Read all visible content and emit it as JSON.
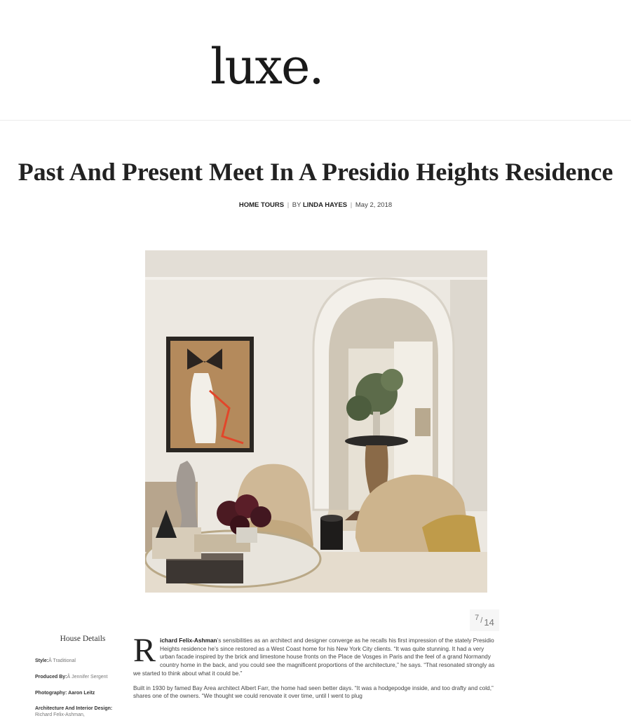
{
  "site": {
    "logo": "luxe."
  },
  "article": {
    "title": "Past And Present Meet In A Presidio Heights Residence",
    "category": "HOME TOURS",
    "separator": "|",
    "by_label": "BY",
    "author": "LINDA HAYES",
    "date": "May 2, 2018",
    "dropcap": "R",
    "lead_name": "ichard Felix-Ashman",
    "paragraph1_rest": "’s sensibilities as an architect and designer converge as he recalls his first impression of the stately Presidio Heights residence he’s since restored as a West Coast home for his New York City clients. “It was quite stunning. It had a very urban facade inspired by the brick and limestone house fronts on the Place de Vosges in Paris and the feel of a grand Normandy country home in the back, and you could see the magnificent proportions of the architecture,” he says. “That resonated strongly as we started to think about what it could be.”",
    "paragraph2": "Built in 1930 by famed Bay Area architect Albert Farr, the home had seen better days. “It was a hodgepodge inside, and too drafty and cold,” shares one of the owners. “We thought we could renovate it over time, until I went to plug"
  },
  "gallery": {
    "current": "7",
    "slash": "/",
    "total": "14"
  },
  "house_details": {
    "heading": "House Details",
    "items": [
      {
        "key": "Style:",
        "value": "Â Traditional"
      },
      {
        "key": "Produced By:",
        "value": "Â Jennifer Sergent"
      },
      {
        "key": "Photography: Aaron Leitz",
        "value": ""
      },
      {
        "key": "Architecture And Interior Design:",
        "value": " Richard Felix-Ashman,"
      }
    ]
  },
  "colors": {
    "page_bg": "#ffffff",
    "rule": "#ececec",
    "text": "#444444",
    "pager_bg": "#f6f6f6"
  }
}
